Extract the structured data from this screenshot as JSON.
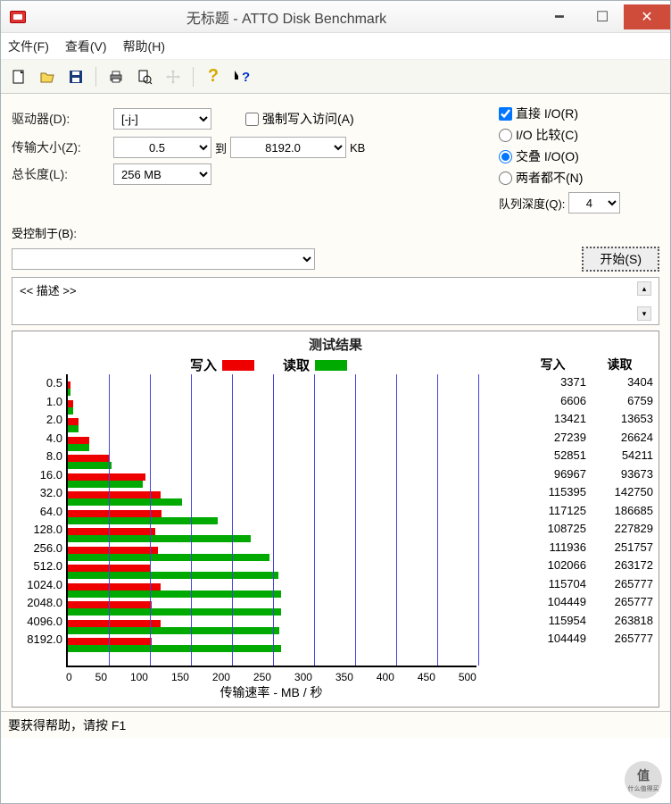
{
  "window": {
    "title": "无标题 - ATTO Disk Benchmark"
  },
  "menus": {
    "file": "文件(F)",
    "view": "查看(V)",
    "help": "帮助(H)"
  },
  "form": {
    "drive_label": "驱动器(D):",
    "drive_value": "[-j-]",
    "transfer_label": "传输大小(Z):",
    "transfer_from": "0.5",
    "to_label": "到",
    "transfer_to": "8192.0",
    "kb": "KB",
    "length_label": "总长度(L):",
    "length_value": "256 MB",
    "force_write": "强制写入访问(A)",
    "direct_io": "直接 I/O(R)",
    "io_compare": "I/O 比较(C)",
    "overlapped": "交叠 I/O(O)",
    "neither": "两者都不(N)",
    "queue_label": "队列深度(Q):",
    "queue_value": "4",
    "controlled_label": "受控制于(B):",
    "start": "开始(S)",
    "desc": "<< 描述 >>"
  },
  "chart": {
    "title": "测试结果",
    "write_label": "写入",
    "read_label": "读取",
    "xlabel": "传输速率 - MB / 秒",
    "xticks": [
      "0",
      "50",
      "100",
      "150",
      "200",
      "250",
      "300",
      "350",
      "400",
      "450",
      "500"
    ]
  },
  "status": "要获得帮助，请按 F1",
  "watermark": "什么值得买",
  "chart_data": {
    "type": "bar",
    "orientation": "horizontal",
    "xlabel": "传输速率 - MB / 秒",
    "xlim": [
      0,
      500
    ],
    "categories": [
      "0.5",
      "1.0",
      "2.0",
      "4.0",
      "8.0",
      "16.0",
      "32.0",
      "64.0",
      "128.0",
      "256.0",
      "512.0",
      "1024.0",
      "2048.0",
      "4096.0",
      "8192.0"
    ],
    "series": [
      {
        "name": "写入",
        "color": "#e00",
        "values_kb": [
          3371,
          6606,
          13421,
          27239,
          52851,
          96967,
          115395,
          117125,
          108725,
          111936,
          102066,
          115704,
          104449,
          115954,
          104449
        ]
      },
      {
        "name": "读取",
        "color": "#0a0",
        "values_kb": [
          3404,
          6759,
          13653,
          26624,
          54211,
          93673,
          142750,
          186685,
          227829,
          251757,
          263172,
          265777,
          265777,
          263818,
          265777
        ]
      }
    ],
    "value_columns": {
      "write_header": "写入",
      "read_header": "读取"
    }
  }
}
